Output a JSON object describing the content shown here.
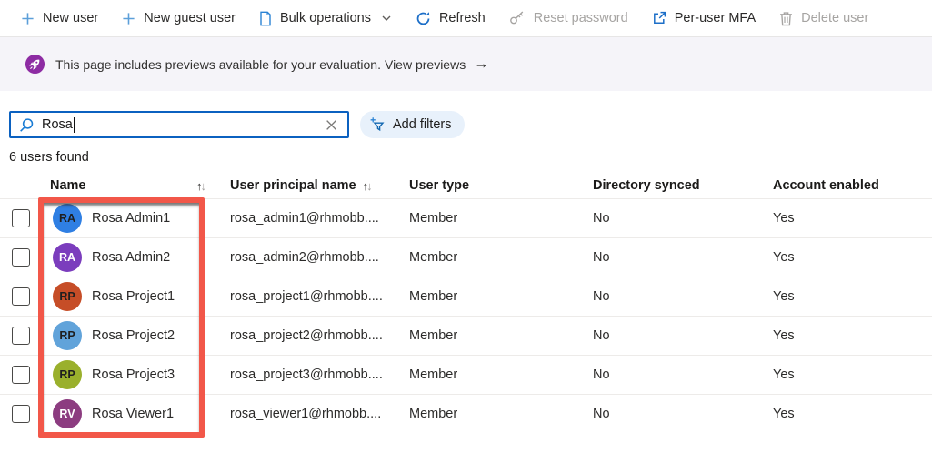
{
  "toolbar": {
    "items": [
      {
        "id": "new-user",
        "label": "New user",
        "icon": "plus-icon",
        "disabled": false,
        "has_menu": false
      },
      {
        "id": "new-guest-user",
        "label": "New guest user",
        "icon": "plus-icon",
        "disabled": false,
        "has_menu": false
      },
      {
        "id": "bulk-operations",
        "label": "Bulk operations",
        "icon": "document-icon",
        "disabled": false,
        "has_menu": true
      },
      {
        "id": "refresh",
        "label": "Refresh",
        "icon": "refresh-icon",
        "disabled": false,
        "has_menu": false
      },
      {
        "id": "reset-password",
        "label": "Reset password",
        "icon": "key-icon",
        "disabled": true,
        "has_menu": false
      },
      {
        "id": "per-user-mfa",
        "label": "Per-user MFA",
        "icon": "external-link-icon",
        "disabled": false,
        "has_menu": false
      },
      {
        "id": "delete-user",
        "label": "Delete user",
        "icon": "trash-icon",
        "disabled": true,
        "has_menu": false
      }
    ]
  },
  "banner": {
    "icon": "rocket-icon",
    "message": "This page includes previews available for your evaluation.",
    "link_label": "View previews",
    "arrow": "→"
  },
  "search": {
    "value": "Rosa",
    "icon": "search-icon",
    "clear_icon": "close-icon"
  },
  "filters": {
    "add_filters_label": "Add filters"
  },
  "results_count": "6 users found",
  "table": {
    "sort_up": "↑",
    "sort_down": "↓",
    "columns": [
      {
        "label": "Name",
        "sortable": true
      },
      {
        "label": "User principal name",
        "sortable": true
      },
      {
        "label": "User type",
        "sortable": false
      },
      {
        "label": "Directory synced",
        "sortable": false
      },
      {
        "label": "Account enabled",
        "sortable": false
      }
    ],
    "rows": [
      {
        "initials": "RA",
        "avatar_color": "#2f7fe3",
        "initials_color": "#1f1f1f",
        "name": "Rosa Admin1",
        "upn": "rosa_admin1@rhmobb....",
        "user_type": "Member",
        "directory_synced": "No",
        "account_enabled": "Yes"
      },
      {
        "initials": "RA",
        "avatar_color": "#7b3dbd",
        "initials_color": "#ffffff",
        "name": "Rosa Admin2",
        "upn": "rosa_admin2@rhmobb....",
        "user_type": "Member",
        "directory_synced": "No",
        "account_enabled": "Yes"
      },
      {
        "initials": "RP",
        "avatar_color": "#c64d27",
        "initials_color": "#1f1f1f",
        "name": "Rosa Project1",
        "upn": "rosa_project1@rhmobb....",
        "user_type": "Member",
        "directory_synced": "No",
        "account_enabled": "Yes"
      },
      {
        "initials": "RP",
        "avatar_color": "#61a3da",
        "initials_color": "#1f1f1f",
        "name": "Rosa Project2",
        "upn": "rosa_project2@rhmobb....",
        "user_type": "Member",
        "directory_synced": "No",
        "account_enabled": "Yes"
      },
      {
        "initials": "RP",
        "avatar_color": "#9ab02c",
        "initials_color": "#1f1f1f",
        "name": "Rosa Project3",
        "upn": "rosa_project3@rhmobb....",
        "user_type": "Member",
        "directory_synced": "No",
        "account_enabled": "Yes"
      },
      {
        "initials": "RV",
        "avatar_color": "#8c3c80",
        "initials_color": "#ffffff",
        "name": "Rosa Viewer1",
        "upn": "rosa_viewer1@rhmobb....",
        "user_type": "Member",
        "directory_synced": "No",
        "account_enabled": "Yes"
      }
    ]
  },
  "annotation": {
    "color": "#f25749"
  },
  "colors": {
    "accent_blue": "#1d6fc8",
    "light_blue_icon": "#5c9fd9",
    "disabled_gray": "#a6a4a2",
    "banner_bg": "#f5f4f9",
    "banner_icon_purple": "#8d2ba3",
    "search_border": "#0b61c0",
    "add_filters_bg": "#e8f1fb",
    "row_divider": "#edebe9"
  }
}
